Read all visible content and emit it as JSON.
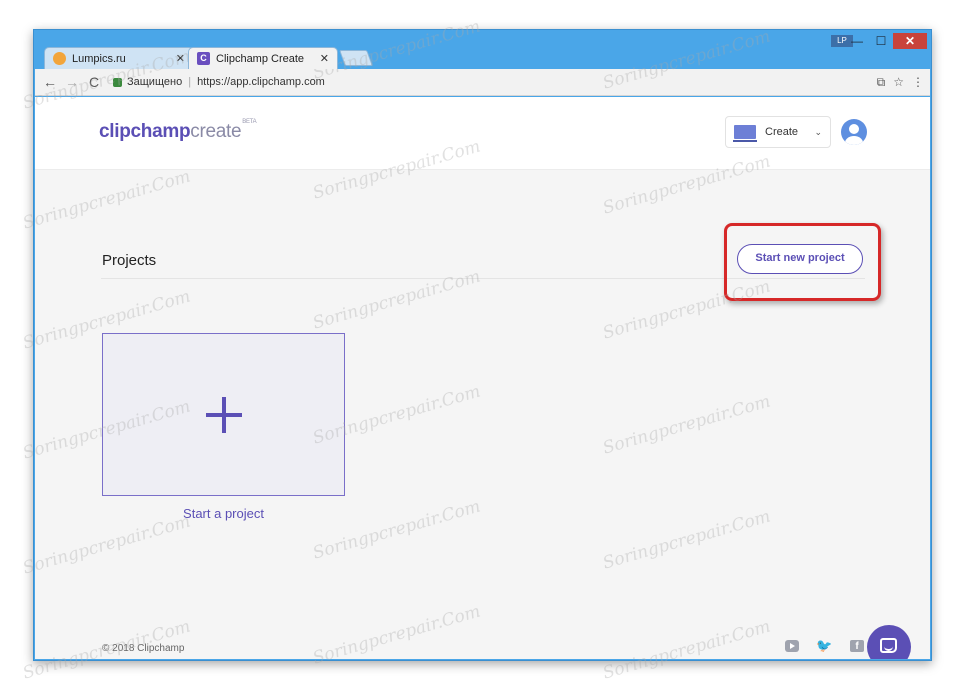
{
  "window": {
    "user_badge": "LP",
    "controls": [
      "—",
      "☐",
      "✕"
    ]
  },
  "tabs": [
    {
      "title": "Lumpics.ru",
      "close": "✕"
    },
    {
      "title": "Clipchamp Create",
      "close": "✕",
      "favicon_letter": "C"
    }
  ],
  "toolbar": {
    "back": "←",
    "forward": "→",
    "reload": "C",
    "secure_label": "Защищено",
    "url": "https://app.clipchamp.com",
    "translate_icon": "⧉",
    "bookmark_icon": "☆",
    "menu_icon": "⋮"
  },
  "app": {
    "logo_main": "clipchamp",
    "logo_sub": "create",
    "logo_badge": "BETA",
    "create_label": "Create",
    "chevron": "⌄"
  },
  "projects": {
    "title": "Projects",
    "start_new": "Start new project",
    "tile_label": "Start a project"
  },
  "footer": {
    "copyright": "© 2018 Clipchamp",
    "twitter_glyph": "🐦",
    "facebook_glyph": "f"
  },
  "watermark": "Soringpcrepair.Com",
  "colors": {
    "brand": "#5b4fb5",
    "highlight": "#d62828",
    "window_frame": "#4aa6e8"
  }
}
